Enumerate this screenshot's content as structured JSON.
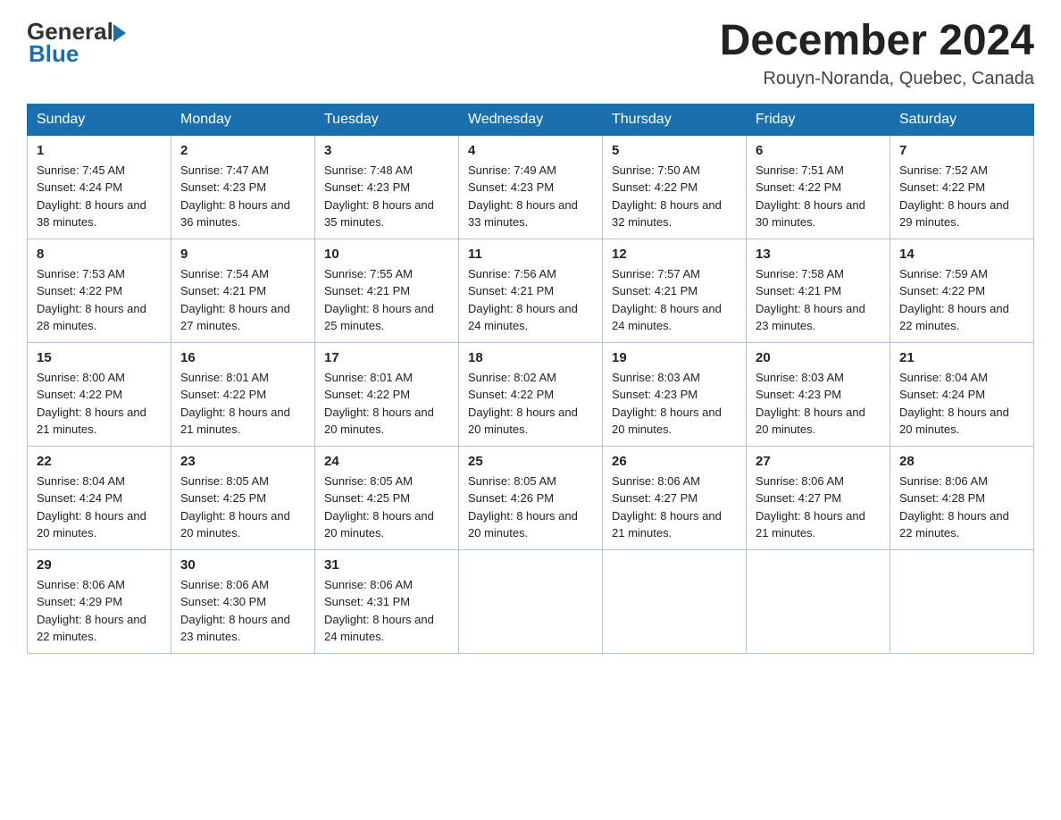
{
  "header": {
    "logo": {
      "text_general": "General",
      "text_blue": "Blue"
    },
    "title": "December 2024",
    "location": "Rouyn-Noranda, Quebec, Canada"
  },
  "calendar": {
    "days_of_week": [
      "Sunday",
      "Monday",
      "Tuesday",
      "Wednesday",
      "Thursday",
      "Friday",
      "Saturday"
    ],
    "weeks": [
      [
        {
          "day": "1",
          "sunrise": "Sunrise: 7:45 AM",
          "sunset": "Sunset: 4:24 PM",
          "daylight": "Daylight: 8 hours and 38 minutes."
        },
        {
          "day": "2",
          "sunrise": "Sunrise: 7:47 AM",
          "sunset": "Sunset: 4:23 PM",
          "daylight": "Daylight: 8 hours and 36 minutes."
        },
        {
          "day": "3",
          "sunrise": "Sunrise: 7:48 AM",
          "sunset": "Sunset: 4:23 PM",
          "daylight": "Daylight: 8 hours and 35 minutes."
        },
        {
          "day": "4",
          "sunrise": "Sunrise: 7:49 AM",
          "sunset": "Sunset: 4:23 PM",
          "daylight": "Daylight: 8 hours and 33 minutes."
        },
        {
          "day": "5",
          "sunrise": "Sunrise: 7:50 AM",
          "sunset": "Sunset: 4:22 PM",
          "daylight": "Daylight: 8 hours and 32 minutes."
        },
        {
          "day": "6",
          "sunrise": "Sunrise: 7:51 AM",
          "sunset": "Sunset: 4:22 PM",
          "daylight": "Daylight: 8 hours and 30 minutes."
        },
        {
          "day": "7",
          "sunrise": "Sunrise: 7:52 AM",
          "sunset": "Sunset: 4:22 PM",
          "daylight": "Daylight: 8 hours and 29 minutes."
        }
      ],
      [
        {
          "day": "8",
          "sunrise": "Sunrise: 7:53 AM",
          "sunset": "Sunset: 4:22 PM",
          "daylight": "Daylight: 8 hours and 28 minutes."
        },
        {
          "day": "9",
          "sunrise": "Sunrise: 7:54 AM",
          "sunset": "Sunset: 4:21 PM",
          "daylight": "Daylight: 8 hours and 27 minutes."
        },
        {
          "day": "10",
          "sunrise": "Sunrise: 7:55 AM",
          "sunset": "Sunset: 4:21 PM",
          "daylight": "Daylight: 8 hours and 25 minutes."
        },
        {
          "day": "11",
          "sunrise": "Sunrise: 7:56 AM",
          "sunset": "Sunset: 4:21 PM",
          "daylight": "Daylight: 8 hours and 24 minutes."
        },
        {
          "day": "12",
          "sunrise": "Sunrise: 7:57 AM",
          "sunset": "Sunset: 4:21 PM",
          "daylight": "Daylight: 8 hours and 24 minutes."
        },
        {
          "day": "13",
          "sunrise": "Sunrise: 7:58 AM",
          "sunset": "Sunset: 4:21 PM",
          "daylight": "Daylight: 8 hours and 23 minutes."
        },
        {
          "day": "14",
          "sunrise": "Sunrise: 7:59 AM",
          "sunset": "Sunset: 4:22 PM",
          "daylight": "Daylight: 8 hours and 22 minutes."
        }
      ],
      [
        {
          "day": "15",
          "sunrise": "Sunrise: 8:00 AM",
          "sunset": "Sunset: 4:22 PM",
          "daylight": "Daylight: 8 hours and 21 minutes."
        },
        {
          "day": "16",
          "sunrise": "Sunrise: 8:01 AM",
          "sunset": "Sunset: 4:22 PM",
          "daylight": "Daylight: 8 hours and 21 minutes."
        },
        {
          "day": "17",
          "sunrise": "Sunrise: 8:01 AM",
          "sunset": "Sunset: 4:22 PM",
          "daylight": "Daylight: 8 hours and 20 minutes."
        },
        {
          "day": "18",
          "sunrise": "Sunrise: 8:02 AM",
          "sunset": "Sunset: 4:22 PM",
          "daylight": "Daylight: 8 hours and 20 minutes."
        },
        {
          "day": "19",
          "sunrise": "Sunrise: 8:03 AM",
          "sunset": "Sunset: 4:23 PM",
          "daylight": "Daylight: 8 hours and 20 minutes."
        },
        {
          "day": "20",
          "sunrise": "Sunrise: 8:03 AM",
          "sunset": "Sunset: 4:23 PM",
          "daylight": "Daylight: 8 hours and 20 minutes."
        },
        {
          "day": "21",
          "sunrise": "Sunrise: 8:04 AM",
          "sunset": "Sunset: 4:24 PM",
          "daylight": "Daylight: 8 hours and 20 minutes."
        }
      ],
      [
        {
          "day": "22",
          "sunrise": "Sunrise: 8:04 AM",
          "sunset": "Sunset: 4:24 PM",
          "daylight": "Daylight: 8 hours and 20 minutes."
        },
        {
          "day": "23",
          "sunrise": "Sunrise: 8:05 AM",
          "sunset": "Sunset: 4:25 PM",
          "daylight": "Daylight: 8 hours and 20 minutes."
        },
        {
          "day": "24",
          "sunrise": "Sunrise: 8:05 AM",
          "sunset": "Sunset: 4:25 PM",
          "daylight": "Daylight: 8 hours and 20 minutes."
        },
        {
          "day": "25",
          "sunrise": "Sunrise: 8:05 AM",
          "sunset": "Sunset: 4:26 PM",
          "daylight": "Daylight: 8 hours and 20 minutes."
        },
        {
          "day": "26",
          "sunrise": "Sunrise: 8:06 AM",
          "sunset": "Sunset: 4:27 PM",
          "daylight": "Daylight: 8 hours and 21 minutes."
        },
        {
          "day": "27",
          "sunrise": "Sunrise: 8:06 AM",
          "sunset": "Sunset: 4:27 PM",
          "daylight": "Daylight: 8 hours and 21 minutes."
        },
        {
          "day": "28",
          "sunrise": "Sunrise: 8:06 AM",
          "sunset": "Sunset: 4:28 PM",
          "daylight": "Daylight: 8 hours and 22 minutes."
        }
      ],
      [
        {
          "day": "29",
          "sunrise": "Sunrise: 8:06 AM",
          "sunset": "Sunset: 4:29 PM",
          "daylight": "Daylight: 8 hours and 22 minutes."
        },
        {
          "day": "30",
          "sunrise": "Sunrise: 8:06 AM",
          "sunset": "Sunset: 4:30 PM",
          "daylight": "Daylight: 8 hours and 23 minutes."
        },
        {
          "day": "31",
          "sunrise": "Sunrise: 8:06 AM",
          "sunset": "Sunset: 4:31 PM",
          "daylight": "Daylight: 8 hours and 24 minutes."
        },
        null,
        null,
        null,
        null
      ]
    ]
  }
}
